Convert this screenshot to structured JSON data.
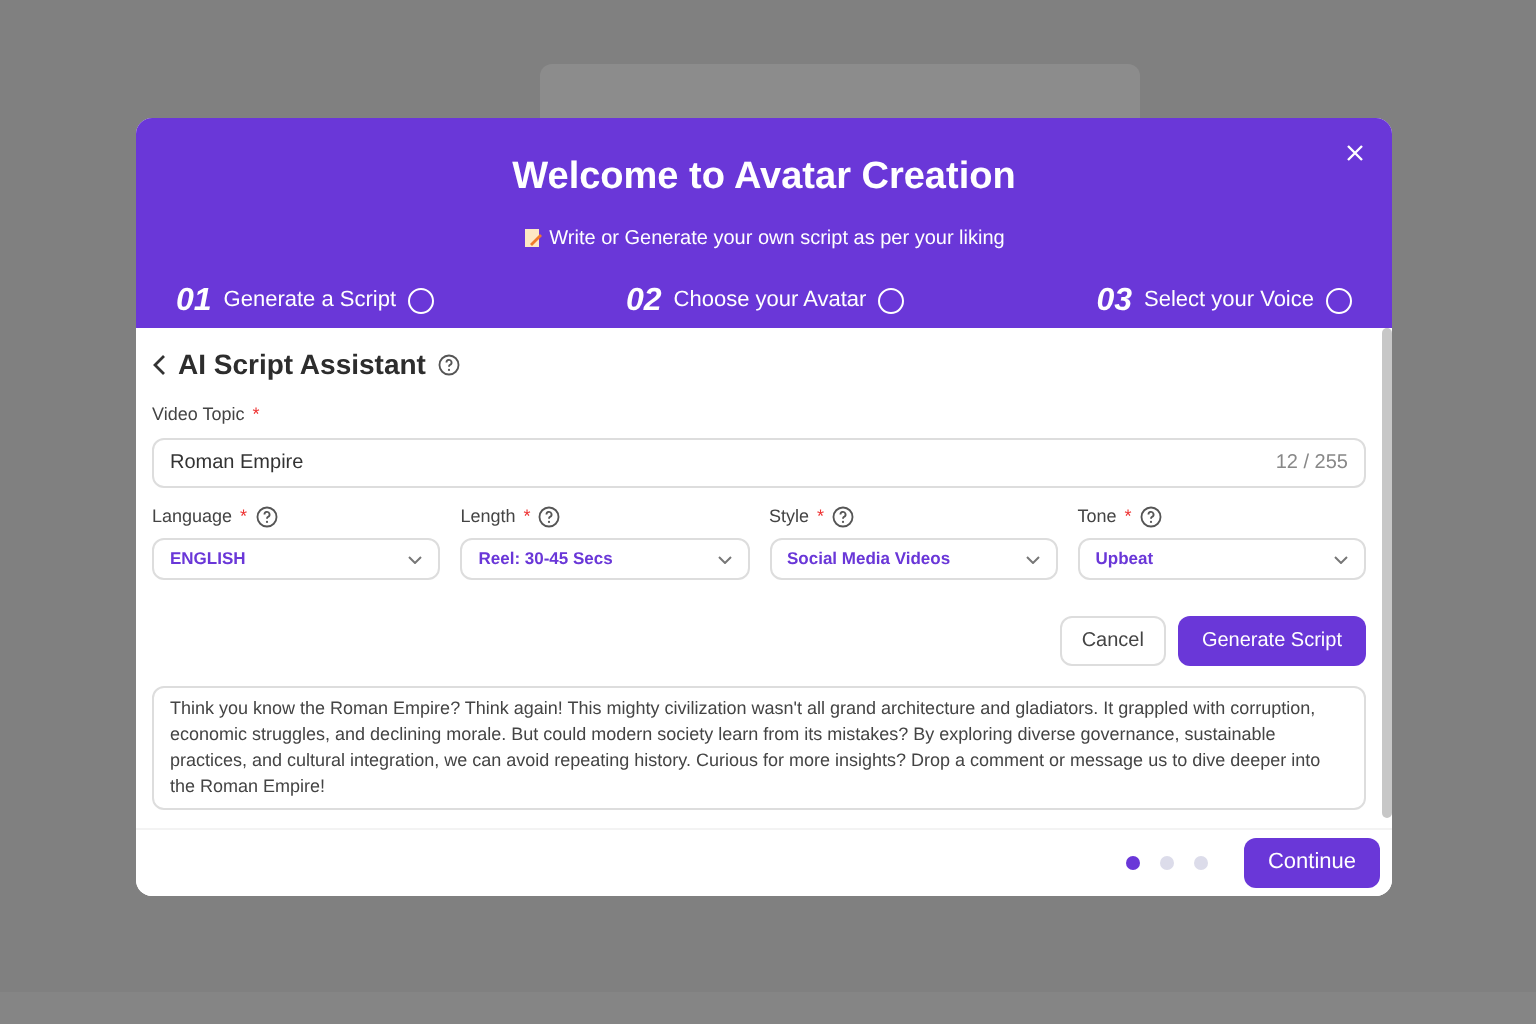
{
  "modal": {
    "title": "Welcome to Avatar Creation",
    "subtitle": "Write or Generate your own script as per your liking",
    "steps": [
      {
        "number": "01",
        "label": "Generate a Script",
        "done": false
      },
      {
        "number": "02",
        "label": "Choose your Avatar",
        "done": false
      },
      {
        "number": "03",
        "label": "Select your Voice",
        "done": false
      }
    ]
  },
  "assistant": {
    "title": "AI Script Assistant",
    "topic": {
      "label": "Video Topic",
      "required_mark": "*",
      "value": "Roman Empire",
      "counter": "12 / 255"
    },
    "selects": [
      {
        "label": "Language",
        "required_mark": "*",
        "value": "ENGLISH"
      },
      {
        "label": "Length",
        "required_mark": "*",
        "value": "Reel: 30-45 Secs"
      },
      {
        "label": "Style",
        "required_mark": "*",
        "value": "Social Media Videos"
      },
      {
        "label": "Tone",
        "required_mark": "*",
        "value": "Upbeat"
      }
    ],
    "buttons": {
      "cancel": "Cancel",
      "generate": "Generate Script"
    },
    "script": "Think you know the Roman Empire? Think again! This mighty civilization wasn't all grand architecture and gladiators. It grappled with corruption, economic struggles, and declining morale. But could modern society learn from its mistakes? By exploring diverse governance, sustainable practices, and cultural integration, we can avoid repeating history. Curious for more insights? Drop a comment or message us to dive deeper into the Roman Empire!"
  },
  "footer": {
    "dots": [
      {
        "selected": true
      },
      {
        "selected": false
      },
      {
        "selected": false
      }
    ],
    "continue": "Continue"
  }
}
